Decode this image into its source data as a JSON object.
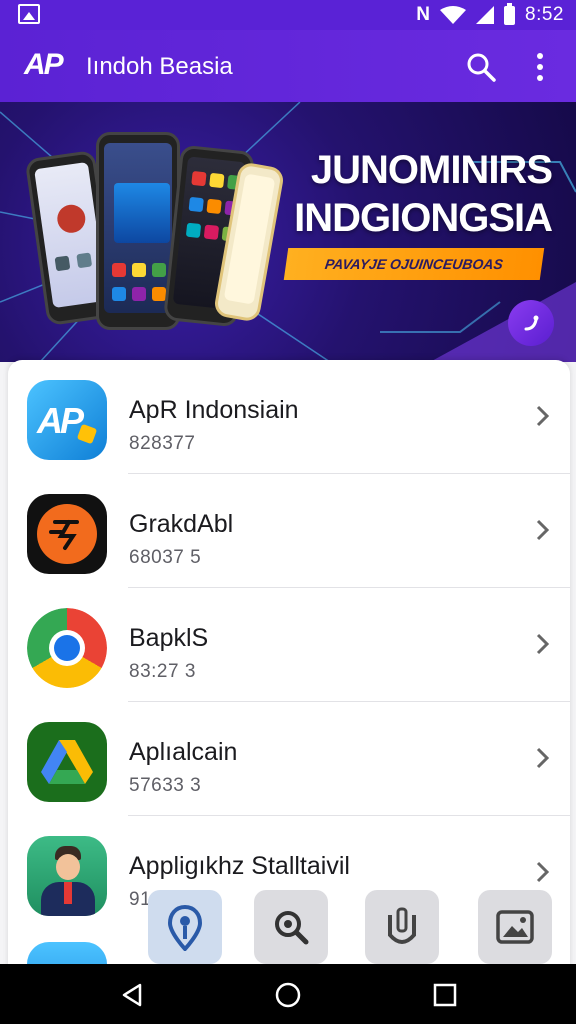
{
  "status_bar": {
    "time": "8:52",
    "icons": [
      "image-icon",
      "nfc-icon",
      "wifi-icon",
      "signal-icon",
      "battery-icon"
    ]
  },
  "app_bar": {
    "logo_text": "AP",
    "title": "Iındoh Beasia",
    "icons": [
      "search-icon",
      "more-vert-icon"
    ]
  },
  "banner": {
    "headline_line1": "JUNOMINIRS",
    "headline_line2": "INDGIONGSIA",
    "cta_label": "PAVAYJE OJUINCEUBOAS",
    "fab_icon": "phone-icon"
  },
  "app_list": [
    {
      "name": "ApR Indonsiain",
      "sub": "828377",
      "icon": "apr-indonesia-app-icon",
      "color": "#1aa3e8"
    },
    {
      "name": "GrakdAbl",
      "sub": "68037 5",
      "icon": "grab-app-icon",
      "color": "#111111"
    },
    {
      "name": "BapklS",
      "sub": "83:27 3",
      "icon": "chrome-app-icon",
      "color": "#ea4335"
    },
    {
      "name": "Aplıalcain",
      "sub": "57633 3",
      "icon": "drive-app-icon",
      "color": "#1b6e1c"
    },
    {
      "name": "Appligıkhz Stalltaivil",
      "sub": "91",
      "icon": "avatar-app-icon",
      "color": "#2aa36b"
    }
  ],
  "bottom_tabs": [
    "location-pin-icon",
    "search-zoom-icon",
    "shield-tag-icon",
    "gallery-icon"
  ],
  "nav_bar": [
    "back-icon",
    "home-icon",
    "recents-icon"
  ],
  "colors": {
    "primary": "#5a22d6",
    "accent": "#ff9f1a",
    "banner_bg": "#24126e"
  }
}
